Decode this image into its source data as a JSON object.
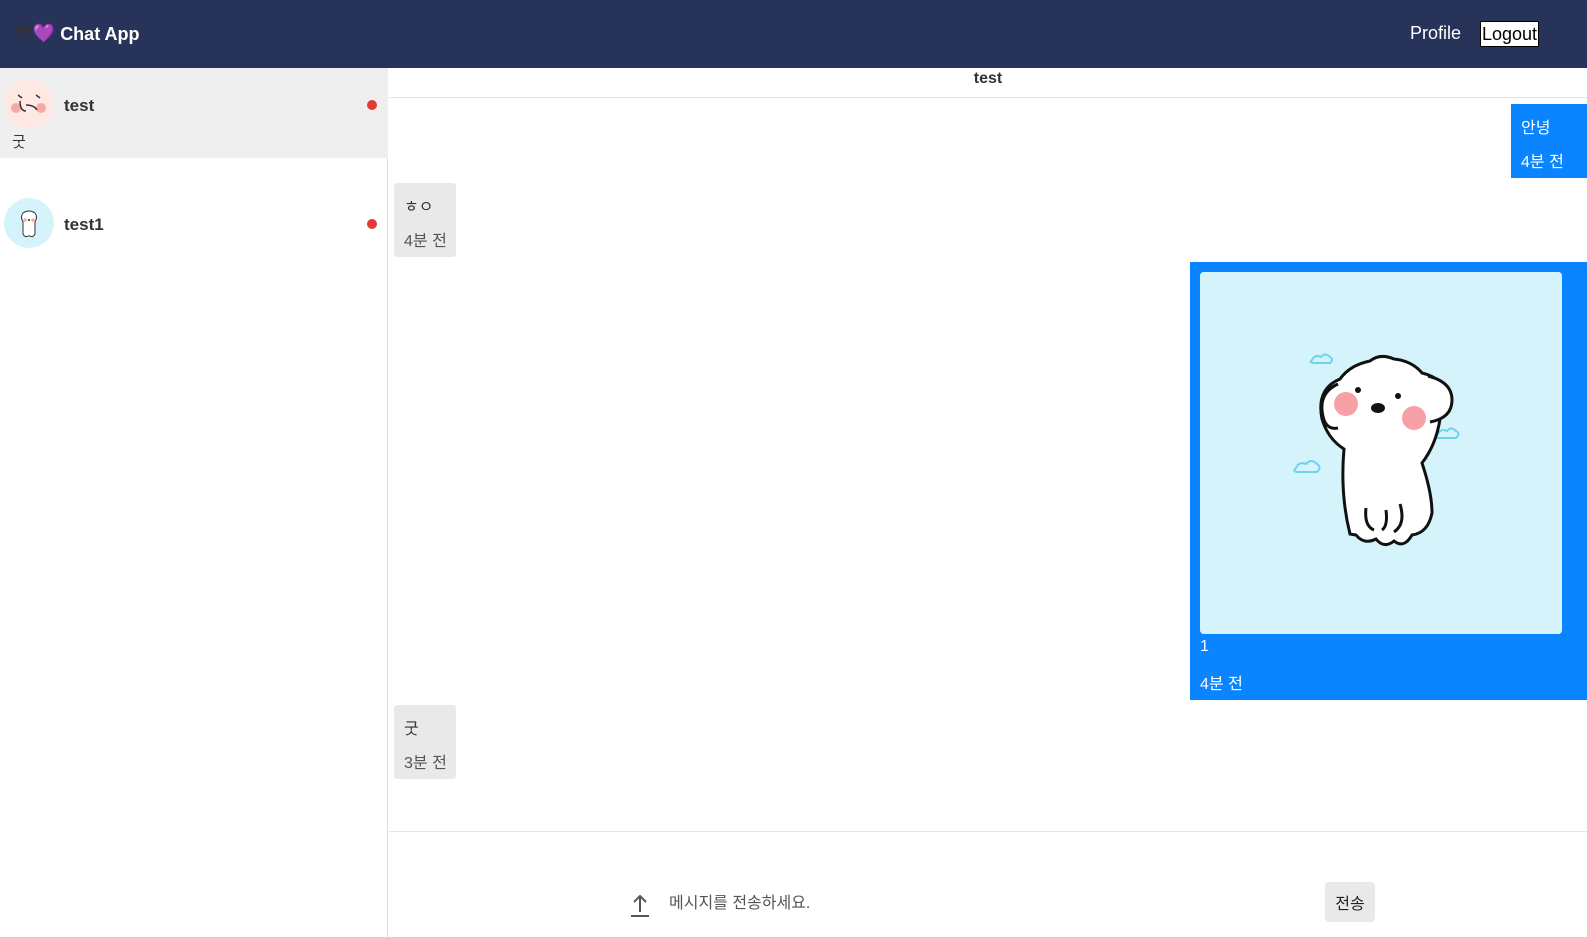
{
  "header": {
    "brand_emoji": "😎💜",
    "brand_title": "Chat App",
    "profile_label": "Profile",
    "logout_label": "Logout",
    "background_color": "#273359"
  },
  "sidebar": {
    "rooms": [
      {
        "name": "test",
        "last_message": "굿",
        "unread": true,
        "active": true,
        "avatar": "blushing-face-icon"
      },
      {
        "name": "test1",
        "unread": true,
        "active": false,
        "avatar": "puppy-avatar-icon"
      }
    ]
  },
  "chat": {
    "title": "test",
    "messages": [
      {
        "sender": "me",
        "text": "안녕",
        "time": "4분 전"
      },
      {
        "sender": "other",
        "text": "ㅎㅇ",
        "time": "4분 전"
      },
      {
        "sender": "me",
        "image": "white-puppy-sticker",
        "text": "1",
        "time": "4분 전"
      },
      {
        "sender": "other",
        "text": "굿",
        "time": "3분 전"
      }
    ],
    "mine_bubble_color": "#0a84ff",
    "other_bubble_color": "#e9e9e9"
  },
  "composer": {
    "placeholder": "메시지를 전송하세요.",
    "value": "",
    "send_label": "전송",
    "upload_icon": "upload-arrow-icon"
  }
}
